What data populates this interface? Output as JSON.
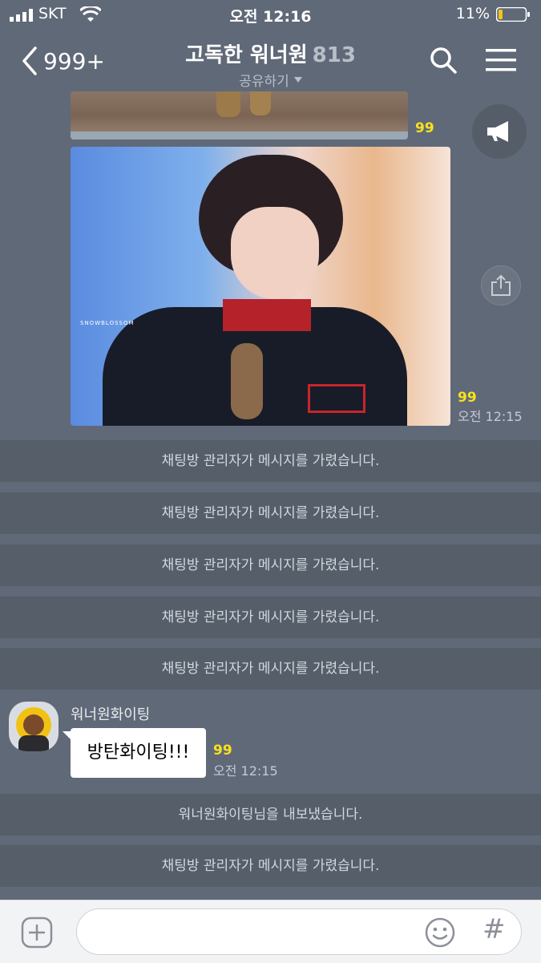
{
  "status_bar": {
    "carrier": "SKT",
    "time": "오전 12:16",
    "battery": "11%"
  },
  "header": {
    "back_count": "999+",
    "title": "고독한 워너원",
    "member_count": "813",
    "share": "공유하기"
  },
  "messages": {
    "photo_top_unread": "99",
    "photo_main_unread": "99",
    "photo_main_time": "오전 12:15",
    "photo_watermark": "SNOWBLOSSOM",
    "system_hidden": "채팅방 관리자가 메시지를 가렸습니다.",
    "sender_name": "워너원화이팅",
    "chat_text": "방탄화이팅!!!",
    "chat_unread": "99",
    "chat_time": "오전 12:15",
    "kicked_notice": "워너원화이팅님을 내보냈습니다."
  },
  "input": {
    "hash": "#"
  },
  "icons": [
    "signal-icon",
    "wifi-icon",
    "battery-icon",
    "back-chevron-icon",
    "search-icon",
    "menu-icon",
    "megaphone-icon",
    "share-icon",
    "plus-icon",
    "emoji-icon",
    "hash-icon"
  ],
  "colors": {
    "background": "#606978",
    "unread": "#f8e11d",
    "system_band": "#565e6a",
    "input_bar": "#f2f3f5"
  }
}
